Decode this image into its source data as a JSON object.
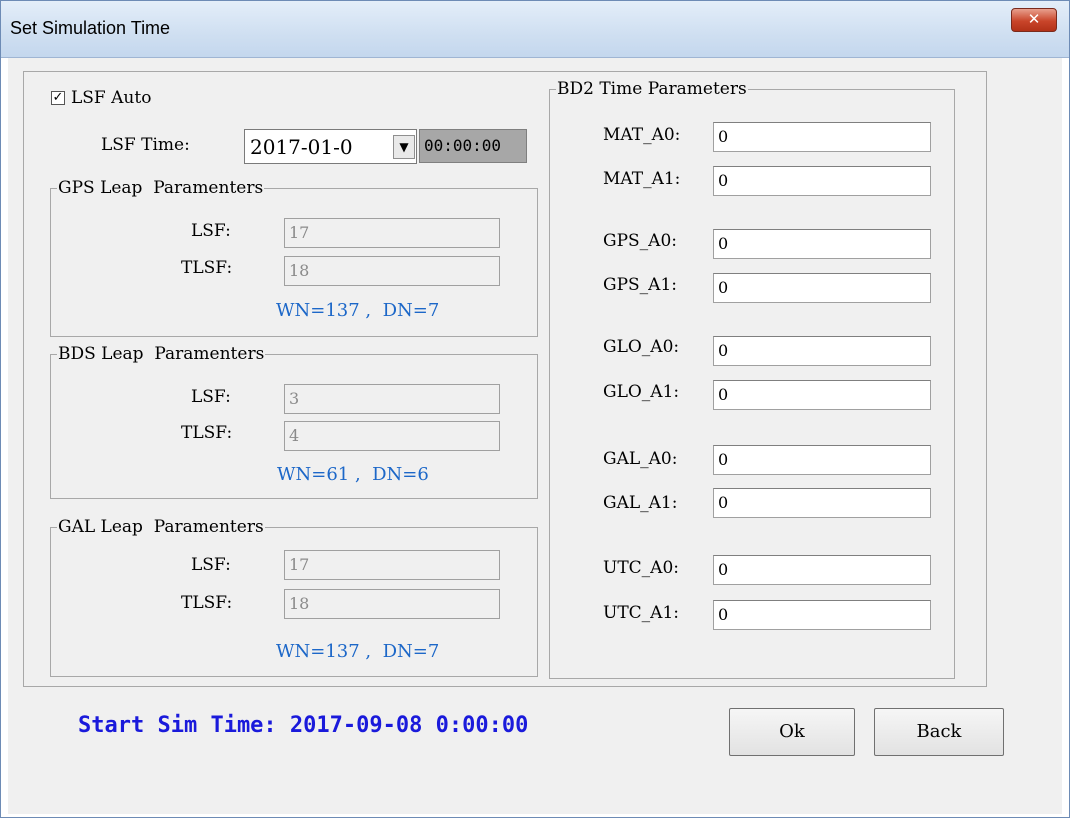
{
  "window": {
    "title": "Set Simulation Time",
    "close_glyph": "✕"
  },
  "lsf": {
    "auto_checked": true,
    "auto_label": "LSF Auto",
    "time_label": "LSF Time:",
    "date_value": "2017-01-0",
    "time_value": "00:00:00"
  },
  "groups": [
    {
      "title": "GPS Leap  Paramenters",
      "lsf_label": "LSF:",
      "lsf_value": "17",
      "tlsf_label": "TLSF:",
      "tlsf_value": "18",
      "wn_dn": "WN=137 ,  DN=7"
    },
    {
      "title": "BDS Leap  Paramenters",
      "lsf_label": "LSF:",
      "lsf_value": "3",
      "tlsf_label": "TLSF:",
      "tlsf_value": "4",
      "wn_dn": "WN=61 ,  DN=6"
    },
    {
      "title": "GAL Leap  Paramenters",
      "lsf_label": "LSF:",
      "lsf_value": "17",
      "tlsf_label": "TLSF:",
      "tlsf_value": "18",
      "wn_dn": "WN=137 ,  DN=7"
    }
  ],
  "bd2": {
    "title": "BD2 Time Parameters",
    "params": [
      {
        "label": "MAT_A0:",
        "value": "0"
      },
      {
        "label": "MAT_A1:",
        "value": "0"
      },
      {
        "label": "GPS_A0:",
        "value": "0"
      },
      {
        "label": "GPS_A1:",
        "value": "0"
      },
      {
        "label": "GLO_A0:",
        "value": "0"
      },
      {
        "label": "GLO_A1:",
        "value": "0"
      },
      {
        "label": "GAL_A0:",
        "value": "0"
      },
      {
        "label": "GAL_A1:",
        "value": "0"
      },
      {
        "label": "UTC_A0:",
        "value": "0"
      },
      {
        "label": "UTC_A1:",
        "value": "0"
      }
    ]
  },
  "footer": {
    "start_time": "Start Sim Time: 2017-09-08 0:00:00",
    "ok_label": "Ok",
    "back_label": "Back"
  },
  "colors": {
    "start_time": "#1a1adb",
    "wn_dn": "#1c67c8",
    "close_button": "#c9452a"
  }
}
